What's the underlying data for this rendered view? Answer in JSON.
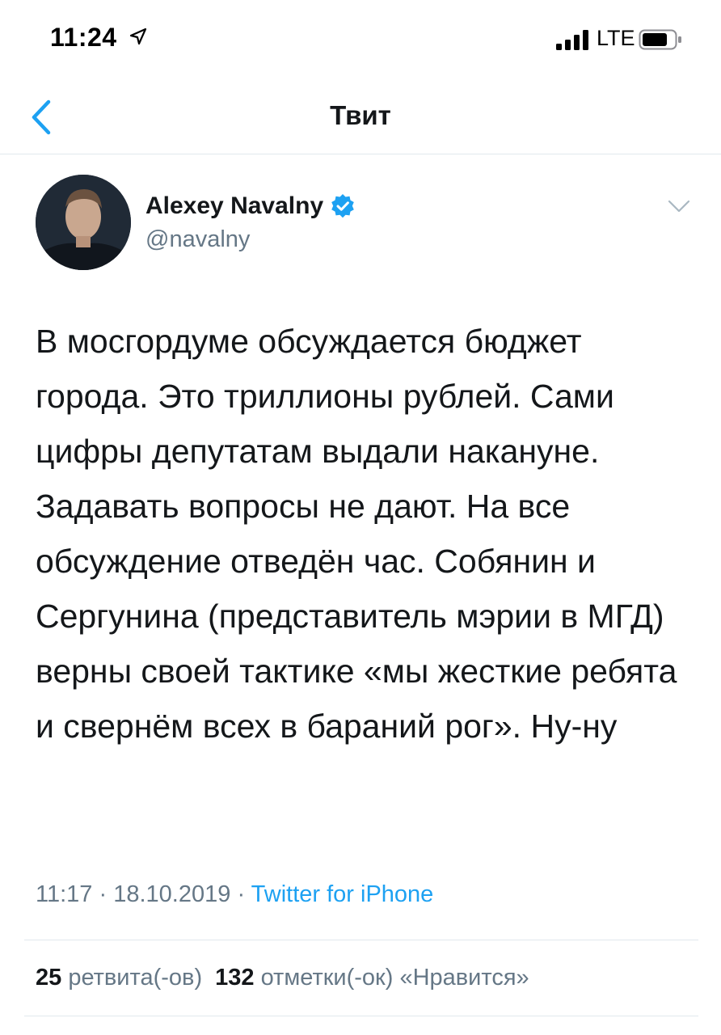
{
  "status_bar": {
    "time": "11:24",
    "network": "LTE",
    "location_icon": "location-arrow-icon",
    "signal_icon": "cell-signal-icon",
    "battery_icon": "battery-icon"
  },
  "nav": {
    "title": "Твит",
    "back_icon": "chevron-left-icon"
  },
  "tweet": {
    "author_name": "Alexey Navalny",
    "author_handle": "@navalny",
    "verified": true,
    "text": "В мосгордуме обсуждается бюджет города. Это триллионы рублей. Сами цифры депутатам выдали накануне. Задавать вопросы не дают. На все обсуждение отведён час. Собянин и Сергунина (представитель мэрии в МГД) верны своей тактике «мы жесткие ребята и свернём всех в бараний рог». Ну-ну",
    "time": "11:17",
    "date": "18.10.2019",
    "separator": "·",
    "source": "Twitter for iPhone",
    "retweets_count": "25",
    "retweets_label": "ретвита(-ов)",
    "likes_count": "132",
    "likes_label": "отметки(-ок) «Нравится»"
  },
  "colors": {
    "accent": "#1da1f2",
    "text_primary": "#14171a",
    "text_secondary": "#657786",
    "divider": "#e1e8ed"
  }
}
